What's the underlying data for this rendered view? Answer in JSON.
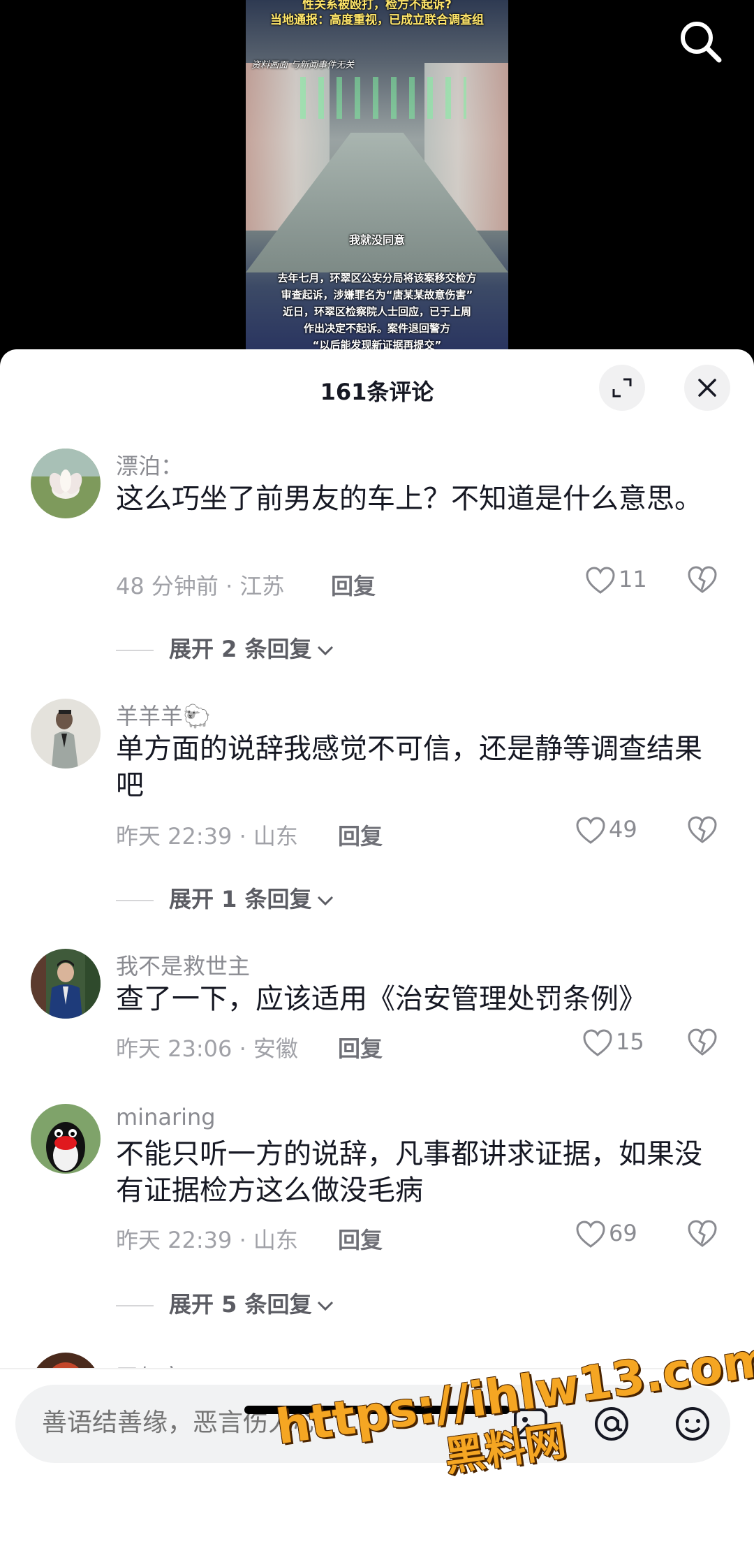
{
  "video": {
    "headline_1": "性关系被殴打，检方不起诉?",
    "headline_2": "当地通报：高度重视，已成立联合调查组",
    "note": "资料画面 与新闻事件无关",
    "subtitle": "我就没同意",
    "caption": [
      "去年七月，环翠区公安分局将该案移交检方",
      "审查起诉，涉嫌罪名为“唐某某故意伤害”",
      "近日，环翠区检察院人士回应，已于上周",
      "作出决定不起诉。案件退回警方",
      "“以后能发现新证据再提交”"
    ],
    "search_icon": "search-icon"
  },
  "sheet": {
    "title": "161条评论",
    "expand_icon": "fullscreen-icon",
    "close_icon": "close-icon"
  },
  "comments": [
    {
      "author": "漂泊：",
      "text": "这么巧坐了前男友的车上？不知道是什么意思。",
      "time_location": "48 分钟前 · 江苏",
      "reply_label": "回复",
      "likes": "11",
      "expand": "展开 2 条回复"
    },
    {
      "author": "羊羊羊🐑",
      "text": "单方面的说辞我感觉不可信，还是静等调查结果吧",
      "time_location": "昨天 22:39 · 山东",
      "reply_label": "回复",
      "likes": "49",
      "expand": "展开 1 条回复"
    },
    {
      "author": "我不是救世主",
      "text": "查了一下，应该适用《治安管理处罚条例》",
      "time_location": "昨天 23:06 · 安徽",
      "reply_label": "回复",
      "likes": "15"
    },
    {
      "author": "minaring",
      "text": "不能只听一方的说辞，凡事都讲求证据，如果没有证据检方这么做没毛病",
      "time_location": "昨天 22:39 · 山东",
      "reply_label": "回复",
      "likes": "69",
      "expand": "展开 5 条回复"
    },
    {
      "author": "天与空"
    }
  ],
  "input": {
    "placeholder": "善语结善缘，恶言伤人心",
    "icons": [
      "image-icon",
      "at-icon",
      "emoji-icon"
    ]
  },
  "watermark": {
    "line1": "https://ihlw13.com",
    "line2": "黑料网"
  },
  "colors": {
    "text_primary": "#161823",
    "text_secondary": "#8a8b91",
    "watermark": "#f5a623"
  }
}
